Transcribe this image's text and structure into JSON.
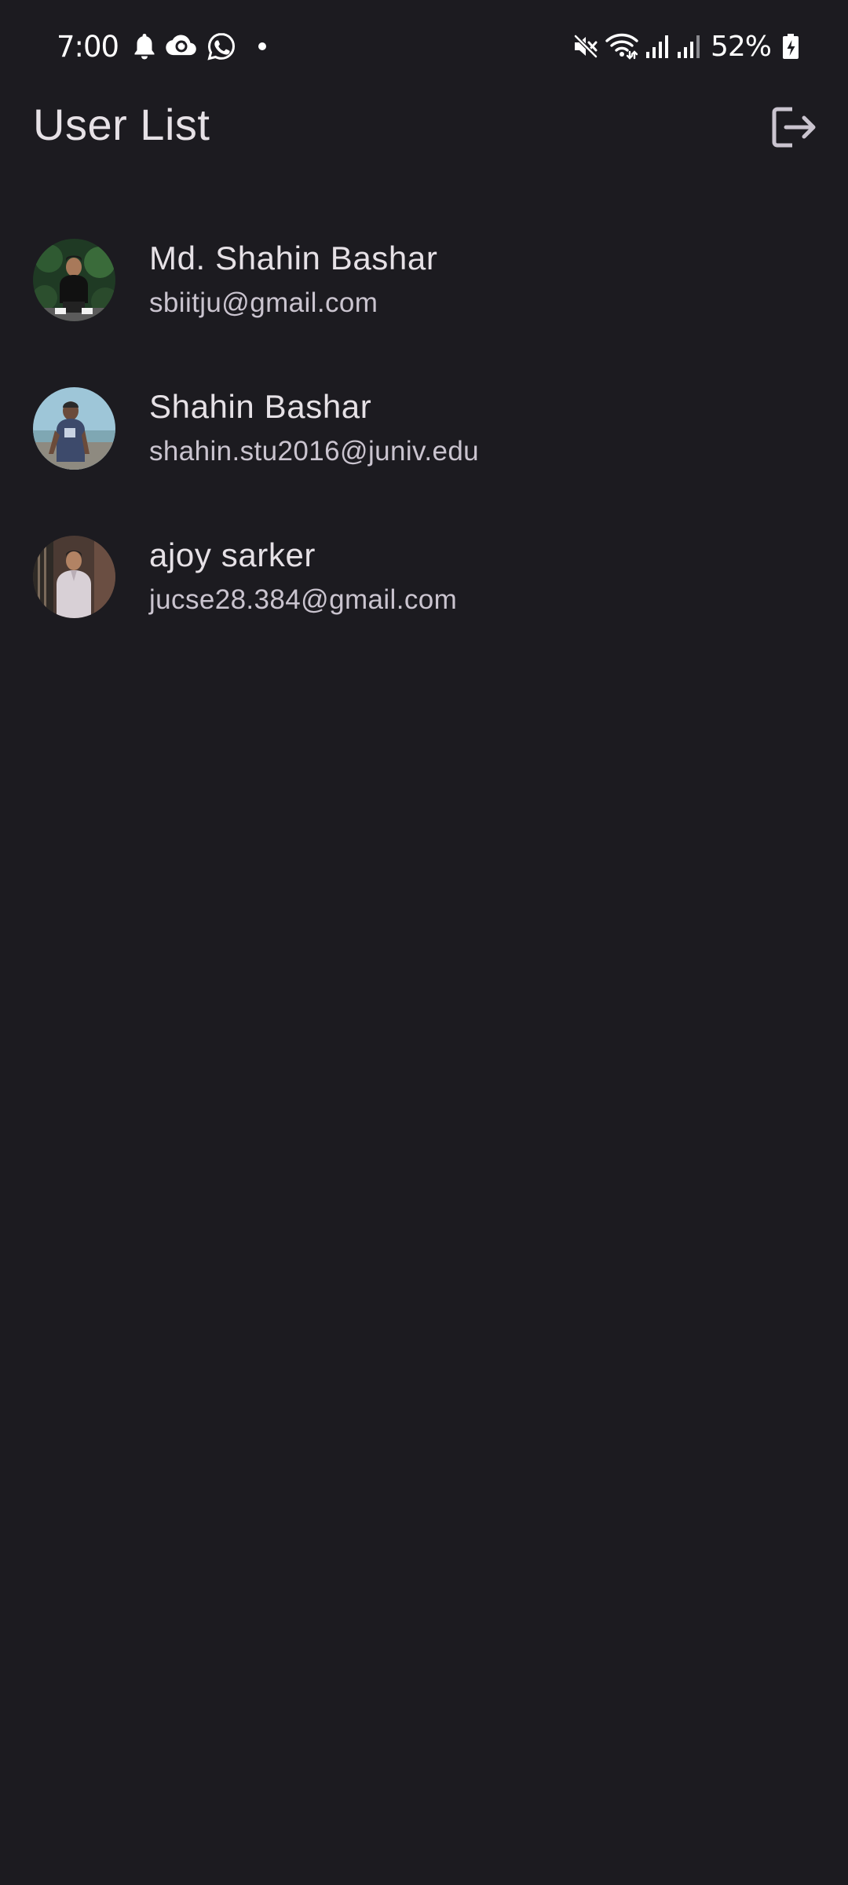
{
  "status_bar": {
    "time": "7:00",
    "left_icons": [
      "bell-icon",
      "cloud-sync-icon",
      "whatsapp-icon",
      "notification-dot"
    ],
    "right_icons": [
      "mute-icon",
      "wifi-icon",
      "signal-icon",
      "signal-icon"
    ],
    "battery_percent": "52%"
  },
  "app_bar": {
    "title": "User List",
    "action_icon": "logout-icon"
  },
  "users": [
    {
      "name": "Md. Shahin Bashar",
      "email": "sbiitju@gmail.com"
    },
    {
      "name": "Shahin Bashar",
      "email": "shahin.stu2016@juniv.edu"
    },
    {
      "name": "ajoy sarker",
      "email": "jucse28.384@gmail.com"
    }
  ],
  "colors": {
    "background": "#1c1b20",
    "text_primary": "#e6e1e6",
    "text_secondary": "#cac4cf"
  }
}
